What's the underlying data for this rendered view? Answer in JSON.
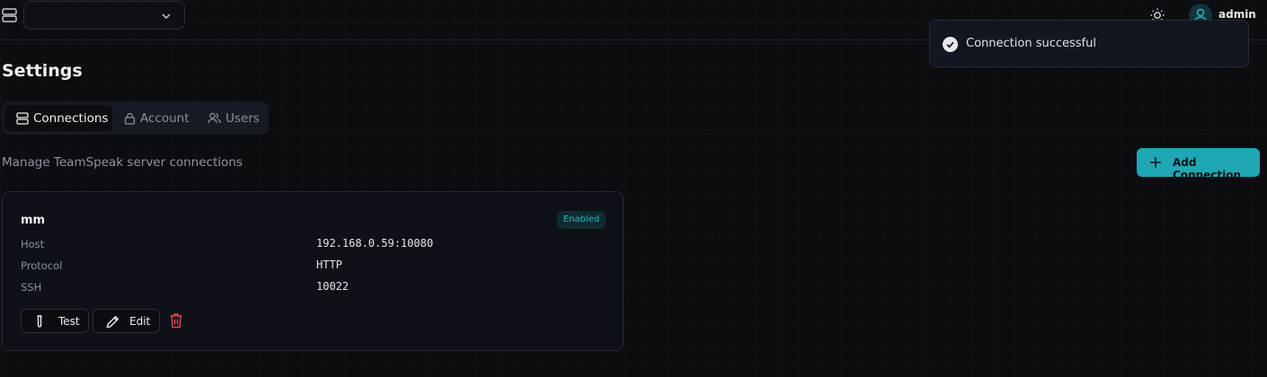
{
  "header": {
    "server_select_value": "",
    "user_name": "admin"
  },
  "toast": {
    "message": "Connection successful"
  },
  "page": {
    "title": "Settings",
    "subtitle": "Manage TeamSpeak server connections"
  },
  "tabs": [
    {
      "label": "Connections",
      "icon": "server-icon",
      "active": true
    },
    {
      "label": "Account",
      "icon": "lock-icon",
      "active": false
    },
    {
      "label": "Users",
      "icon": "users-icon",
      "active": false
    }
  ],
  "actions": {
    "add_connection_label": "Add Connection"
  },
  "connections": [
    {
      "name": "mm",
      "status": "Enabled",
      "fields": [
        {
          "label": "Host",
          "value": "192.168.0.59:10080"
        },
        {
          "label": "Protocol",
          "value": "HTTP"
        },
        {
          "label": "SSH",
          "value": "10022"
        }
      ],
      "buttons": {
        "test": "Test",
        "edit": "Edit"
      }
    }
  ],
  "colors": {
    "accent": "#1fa7b4",
    "background": "#0b0d11",
    "danger": "#e5484d"
  }
}
